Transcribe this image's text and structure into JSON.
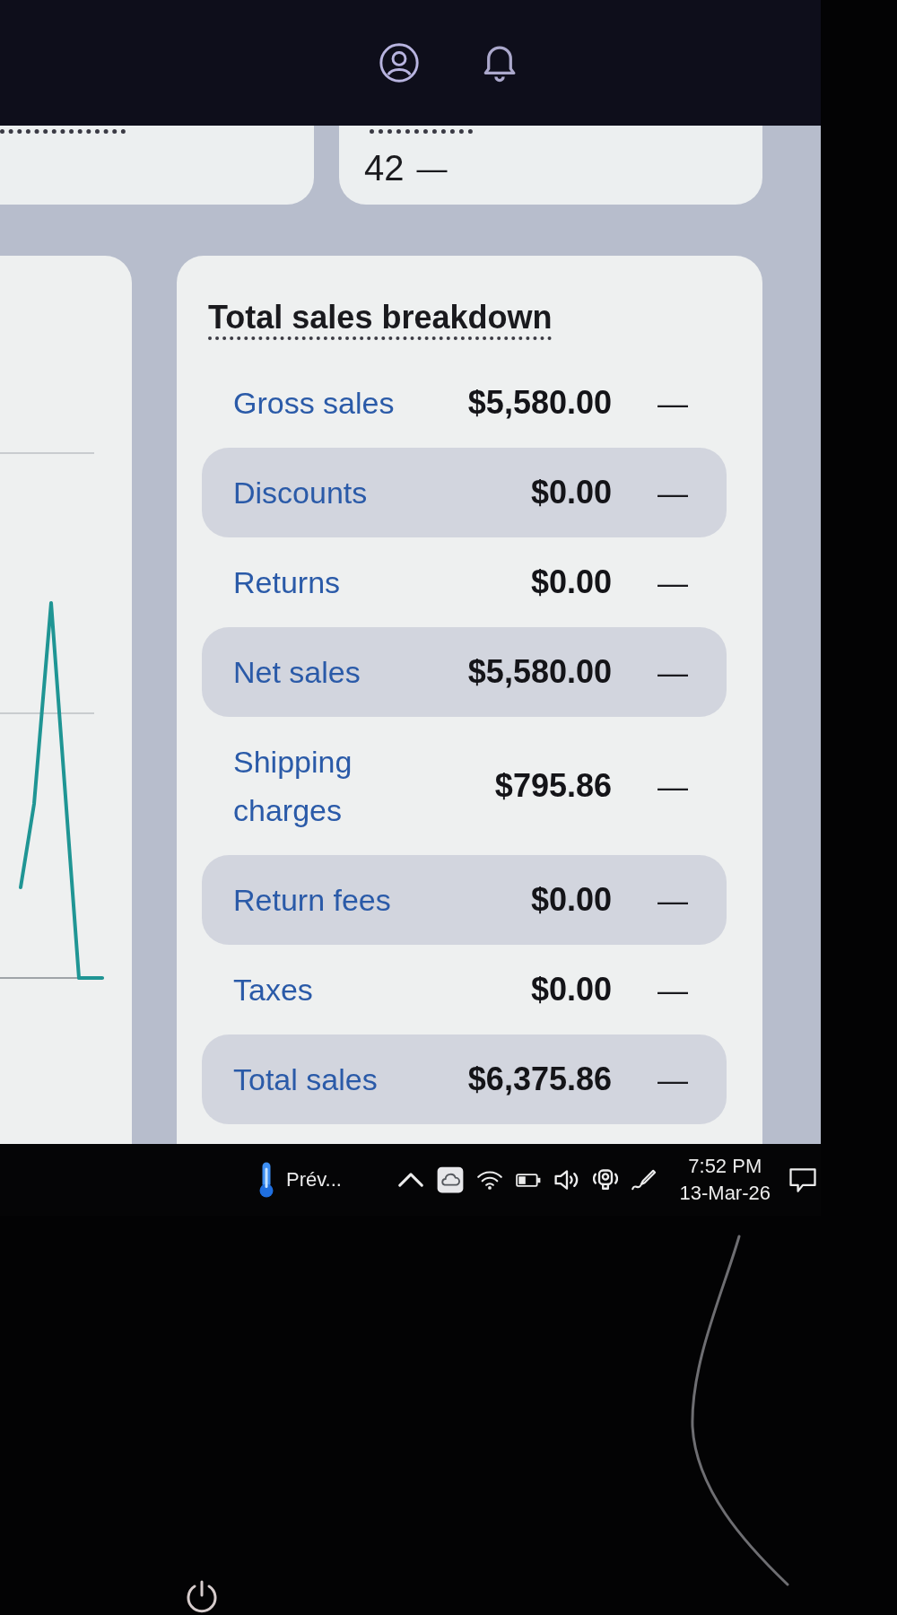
{
  "kpi_cards": [
    {
      "value": "42",
      "change": "—"
    }
  ],
  "breakdown": {
    "title": "Total sales breakdown",
    "rows": [
      {
        "label": "Gross sales",
        "value": "$5,580.00",
        "change": "—",
        "highlighted": false
      },
      {
        "label": "Discounts",
        "value": "$0.00",
        "change": "—",
        "highlighted": true
      },
      {
        "label": "Returns",
        "value": "$0.00",
        "change": "—",
        "highlighted": false
      },
      {
        "label": "Net sales",
        "value": "$5,580.00",
        "change": "—",
        "highlighted": true
      },
      {
        "label": "Shipping charges",
        "value": "$795.86",
        "change": "—",
        "highlighted": false
      },
      {
        "label": "Return fees",
        "value": "$0.00",
        "change": "—",
        "highlighted": true
      },
      {
        "label": "Taxes",
        "value": "$0.00",
        "change": "—",
        "highlighted": false
      },
      {
        "label": "Total sales",
        "value": "$6,375.86",
        "change": "—",
        "highlighted": true
      }
    ]
  },
  "taskbar": {
    "apps": [
      {
        "label": "Prév..."
      }
    ],
    "clock": {
      "time": "7:52 PM",
      "date": "13-Mar-26"
    }
  }
}
